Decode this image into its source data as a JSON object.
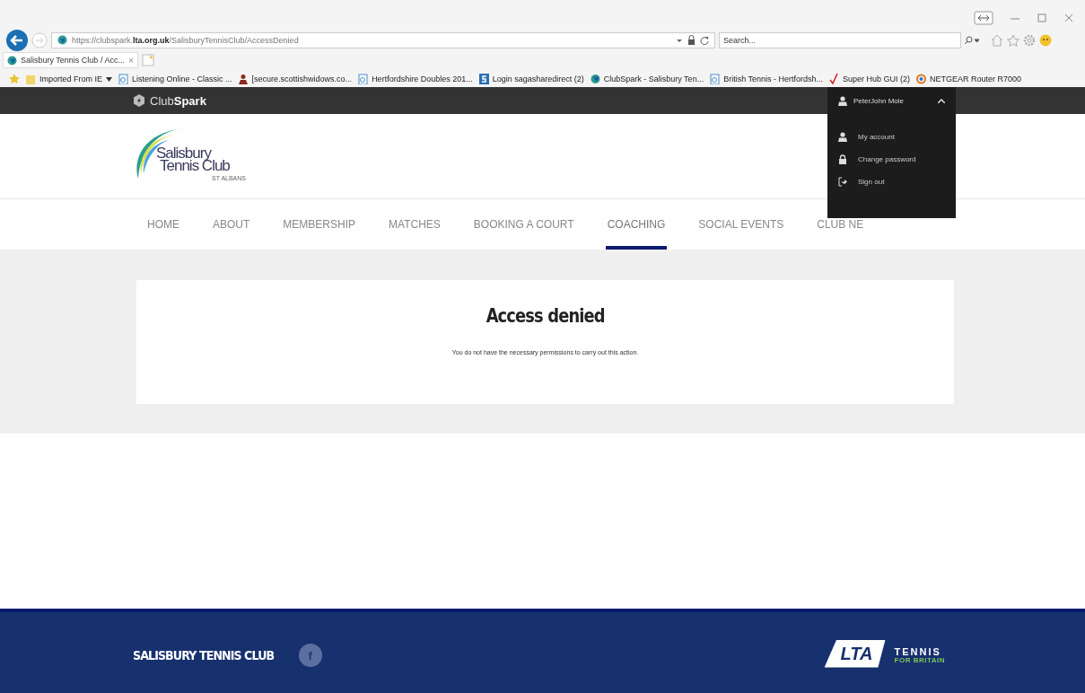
{
  "browser": {
    "address": "https://clubspark.**lta.org.uk**/SalisburyTennisClub/AccessDenied",
    "search": {
      "placeholder": "Search..."
    },
    "tabs": [
      {
        "label": "Salisbury Tennis Club / Acc...",
        "selected": true,
        "close": "×"
      }
    ],
    "bookmarks": [
      {
        "label": "Imported From IE",
        "kind": "folder"
      },
      {
        "label": "Listening Online - Classic ...",
        "kind": "page"
      },
      {
        "label": "[secure.scottishwidows.co...",
        "kind": "person"
      },
      {
        "label": "Hertfordshire Doubles 201...",
        "kind": "page"
      },
      {
        "label": "Login sagasharedirect (2)",
        "kind": "s"
      },
      {
        "label": "ClubSpark - Salisbury Ten...",
        "kind": "globe"
      },
      {
        "label": "British Tennis - Hertfordsh...",
        "kind": "page"
      },
      {
        "label": "Super Hub GUI (2)",
        "kind": "tick"
      },
      {
        "label": "NETGEAR Router R7000",
        "kind": "ring"
      }
    ]
  },
  "topbar": {
    "brand": "Club**Spark**"
  },
  "user_menu": {
    "name": "PeterJohn Mole",
    "expanded": true,
    "items": [
      {
        "label": "My account",
        "kind": "user"
      },
      {
        "label": "Change password",
        "kind": "lock"
      },
      {
        "label": "Sign out",
        "kind": "signout"
      }
    ]
  },
  "logo": {
    "line_1": "Salisbury",
    "line_2": "Tennis Club",
    "line_3": "ST ALBANS"
  },
  "nav": [
    {
      "label": "HOME",
      "selected": false
    },
    {
      "label": "ABOUT",
      "selected": false
    },
    {
      "label": "MEMBERSHIP",
      "selected": false
    },
    {
      "label": "MATCHES",
      "selected": false
    },
    {
      "label": "BOOKING A COURT",
      "selected": false
    },
    {
      "label": "COACHING",
      "selected": true
    },
    {
      "label": "SOCIAL EVENTS",
      "selected": false
    },
    {
      "label": "CLUB NE",
      "selected": false
    }
  ],
  "card": {
    "title": "Access denied",
    "message": "You do not have the necessary permissions to carry out this action."
  },
  "footer": {
    "club_name": "SALISBURY TENNIS CLUB",
    "facebook": "f",
    "lta_logo": "LTA",
    "tagline_1": "TENNIS",
    "tagline_2": "FOR BRITAIN"
  }
}
